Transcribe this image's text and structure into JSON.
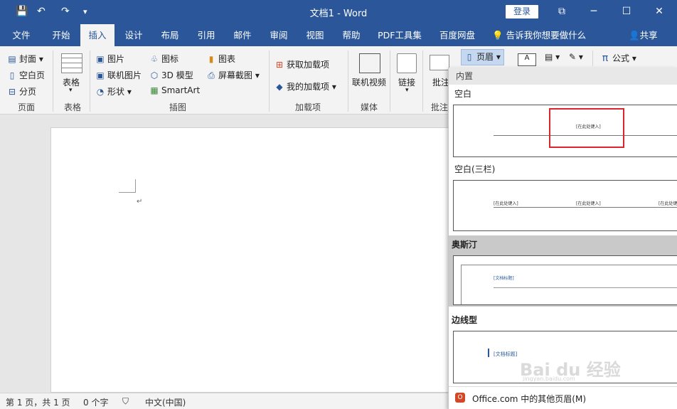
{
  "titlebar": {
    "title": "文档1  -  Word",
    "login": "登录",
    "save_icon": "💾",
    "undo_icon": "↶",
    "redo_icon": "↷",
    "customize_icon": "▾",
    "restore_icon": "⧉",
    "minimize_icon": "─",
    "maximize_icon": "☐",
    "close_icon": "✕"
  },
  "tabs": [
    {
      "label": "文件"
    },
    {
      "label": "开始"
    },
    {
      "label": "插入"
    },
    {
      "label": "设计"
    },
    {
      "label": "布局"
    },
    {
      "label": "引用"
    },
    {
      "label": "邮件"
    },
    {
      "label": "审阅"
    },
    {
      "label": "视图"
    },
    {
      "label": "帮助"
    },
    {
      "label": "PDF工具集"
    },
    {
      "label": "百度网盘"
    }
  ],
  "tell_me": "告诉我你想要做什么",
  "share": "共享",
  "ribbon": {
    "pages": {
      "cover": "封面",
      "blank": "空白页",
      "break": "分页",
      "group": "页面"
    },
    "tables": {
      "table": "表格",
      "group": "表格"
    },
    "illustrations": {
      "picture": "图片",
      "online_picture": "联机图片",
      "shapes": "形状",
      "icons": "图标",
      "model3d": "3D 模型",
      "smartart": "SmartArt",
      "chart": "图表",
      "screenshot": "屏幕截图",
      "group": "插图"
    },
    "addins": {
      "get": "获取加载项",
      "mine": "我的加载项",
      "group": "加载项"
    },
    "media": {
      "video": "联机视频",
      "group": "媒体"
    },
    "links": {
      "link": "链接"
    },
    "comments": {
      "comment": "批注",
      "group": "批注"
    },
    "header": {
      "label": "页眉"
    },
    "equation": {
      "label": "公式",
      "symbol": "π"
    }
  },
  "status": {
    "page": "第 1 页，共 1 页",
    "words": "0 个字",
    "language": "中文(中国)"
  },
  "panel": {
    "category": "内置",
    "templates": [
      {
        "name": "空白",
        "placeholder": "[在此处键入]"
      },
      {
        "name": "空白(三栏)",
        "placeholder": "[在此处键入]"
      },
      {
        "name": "奥斯汀",
        "placeholder": "[文档标题]"
      },
      {
        "name": "边线型",
        "placeholder": "[文档标题]"
      }
    ],
    "footer": "Office.com 中的其他页眉(M)",
    "watermark": "Bai du 经验",
    "watermark_sub": "jingyan.baidu.com"
  }
}
